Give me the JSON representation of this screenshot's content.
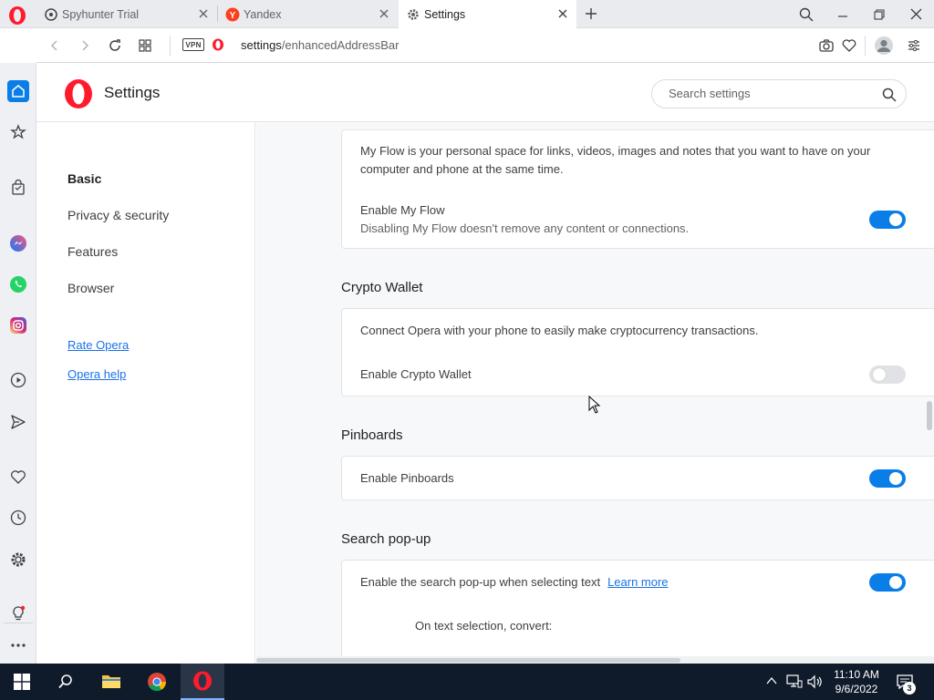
{
  "tabs": [
    {
      "title": "Spyhunter Trial",
      "active": false
    },
    {
      "title": "Yandex",
      "active": false
    },
    {
      "title": "Settings",
      "active": true
    }
  ],
  "address": {
    "host": "settings",
    "path": "/enhancedAddressBar",
    "vpn_label": "VPN"
  },
  "header": {
    "title": "Settings",
    "search_placeholder": "Search settings"
  },
  "leftnav": {
    "items": [
      "Basic",
      "Privacy & security",
      "Features",
      "Browser"
    ],
    "links": [
      "Rate Opera",
      "Opera help"
    ]
  },
  "content": {
    "myflow": {
      "description": "My Flow is your personal space for links, videos, images and notes that you want to have on your computer and phone at the same time.",
      "toggle_label": "Enable My Flow",
      "toggle_sub": "Disabling My Flow doesn't remove any content or connections.",
      "enabled": true
    },
    "crypto": {
      "title": "Crypto Wallet",
      "description": "Connect Opera with your phone to easily make cryptocurrency transactions.",
      "toggle_label": "Enable Crypto Wallet",
      "enabled": false
    },
    "pinboards": {
      "title": "Pinboards",
      "toggle_label": "Enable Pinboards",
      "enabled": true
    },
    "searchpopup": {
      "title": "Search pop-up",
      "toggle_label": "Enable the search pop-up when selecting text",
      "learn_more": "Learn more",
      "enabled": true,
      "convert_label": "On text selection, convert:"
    }
  },
  "taskbar": {
    "time": "11:10 AM",
    "date": "9/6/2022",
    "notifications": "3"
  },
  "colors": {
    "accent": "#0a7ee8",
    "opera_red": "#ff1b2d",
    "taskbar": "#0f1a2b"
  }
}
